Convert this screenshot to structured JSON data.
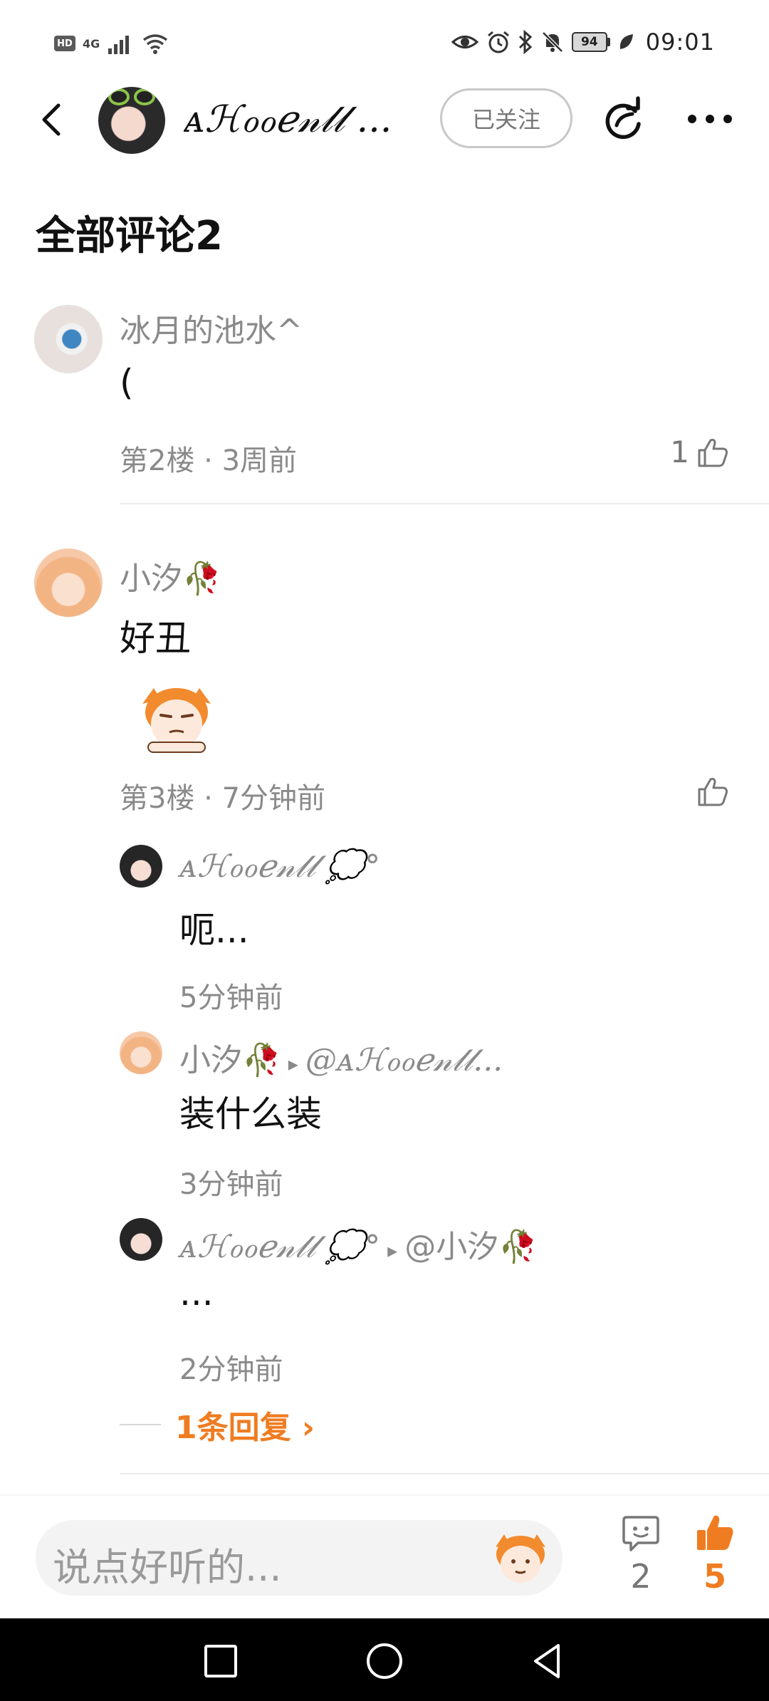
{
  "status_bar": {
    "left_badge": "HD",
    "network": "4G",
    "battery": "94",
    "time": "09:01"
  },
  "header": {
    "name": "ᴀℋℴℴℯ𝓃𝓁𝓁 ...",
    "follow_label": "已关注"
  },
  "section_title": "全部评论2",
  "comments": [
    {
      "username": "冰月的池水^",
      "text": "(",
      "meta": "第2楼 · 3周前",
      "likes": "1"
    },
    {
      "username": "小汐",
      "flower": "🥀",
      "text": "好丑",
      "meta": "第3楼 · 7分钟前",
      "likes": "",
      "replies": [
        {
          "username": "ᴀℋℴℴℯ𝓃𝓁𝓁 💭°",
          "target": "",
          "text": "呃...",
          "time": "5分钟前"
        },
        {
          "username": "小汐",
          "flower": "🥀",
          "target": "@ᴀℋℴℴℯ𝓃𝓁𝓁...",
          "text": "装什么装",
          "time": "3分钟前"
        },
        {
          "username": "ᴀℋℴℴℯ𝓃𝓁𝓁 💭°",
          "target": "@小汐",
          "target_flower": "🥀",
          "text": "...",
          "time": "2分钟前"
        }
      ],
      "more_replies": "1条回复 ›"
    }
  ],
  "bottom": {
    "placeholder": "说点好听的...",
    "comment_count": "2",
    "like_count": "5"
  },
  "colors": {
    "accent": "#f07c21",
    "muted": "#8a8a8a",
    "text": "#111111"
  },
  "icons": [
    "back-icon",
    "share-icon",
    "more-icon",
    "like-icon",
    "comment-icon",
    "thumb-up-icon",
    "emoji-sticker-icon",
    "nav-square-icon",
    "nav-circle-icon",
    "nav-triangle-icon"
  ]
}
